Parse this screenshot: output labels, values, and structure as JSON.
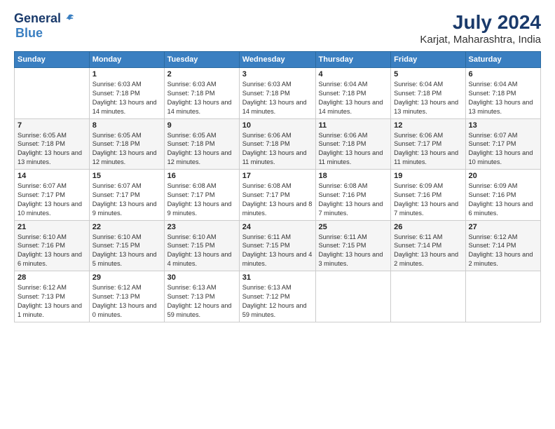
{
  "logo": {
    "general": "General",
    "blue": "Blue"
  },
  "title": "July 2024",
  "subtitle": "Karjat, Maharashtra, India",
  "weekdays": [
    "Sunday",
    "Monday",
    "Tuesday",
    "Wednesday",
    "Thursday",
    "Friday",
    "Saturday"
  ],
  "weeks": [
    [
      {
        "day": null
      },
      {
        "day": "1",
        "sunrise": "6:03 AM",
        "sunset": "7:18 PM",
        "daylight": "13 hours and 14 minutes."
      },
      {
        "day": "2",
        "sunrise": "6:03 AM",
        "sunset": "7:18 PM",
        "daylight": "13 hours and 14 minutes."
      },
      {
        "day": "3",
        "sunrise": "6:03 AM",
        "sunset": "7:18 PM",
        "daylight": "13 hours and 14 minutes."
      },
      {
        "day": "4",
        "sunrise": "6:04 AM",
        "sunset": "7:18 PM",
        "daylight": "13 hours and 14 minutes."
      },
      {
        "day": "5",
        "sunrise": "6:04 AM",
        "sunset": "7:18 PM",
        "daylight": "13 hours and 13 minutes."
      },
      {
        "day": "6",
        "sunrise": "6:04 AM",
        "sunset": "7:18 PM",
        "daylight": "13 hours and 13 minutes."
      }
    ],
    [
      {
        "day": "7",
        "sunrise": "6:05 AM",
        "sunset": "7:18 PM",
        "daylight": "13 hours and 13 minutes."
      },
      {
        "day": "8",
        "sunrise": "6:05 AM",
        "sunset": "7:18 PM",
        "daylight": "13 hours and 12 minutes."
      },
      {
        "day": "9",
        "sunrise": "6:05 AM",
        "sunset": "7:18 PM",
        "daylight": "13 hours and 12 minutes."
      },
      {
        "day": "10",
        "sunrise": "6:06 AM",
        "sunset": "7:18 PM",
        "daylight": "13 hours and 11 minutes."
      },
      {
        "day": "11",
        "sunrise": "6:06 AM",
        "sunset": "7:18 PM",
        "daylight": "13 hours and 11 minutes."
      },
      {
        "day": "12",
        "sunrise": "6:06 AM",
        "sunset": "7:17 PM",
        "daylight": "13 hours and 11 minutes."
      },
      {
        "day": "13",
        "sunrise": "6:07 AM",
        "sunset": "7:17 PM",
        "daylight": "13 hours and 10 minutes."
      }
    ],
    [
      {
        "day": "14",
        "sunrise": "6:07 AM",
        "sunset": "7:17 PM",
        "daylight": "13 hours and 10 minutes."
      },
      {
        "day": "15",
        "sunrise": "6:07 AM",
        "sunset": "7:17 PM",
        "daylight": "13 hours and 9 minutes."
      },
      {
        "day": "16",
        "sunrise": "6:08 AM",
        "sunset": "7:17 PM",
        "daylight": "13 hours and 9 minutes."
      },
      {
        "day": "17",
        "sunrise": "6:08 AM",
        "sunset": "7:17 PM",
        "daylight": "13 hours and 8 minutes."
      },
      {
        "day": "18",
        "sunrise": "6:08 AM",
        "sunset": "7:16 PM",
        "daylight": "13 hours and 7 minutes."
      },
      {
        "day": "19",
        "sunrise": "6:09 AM",
        "sunset": "7:16 PM",
        "daylight": "13 hours and 7 minutes."
      },
      {
        "day": "20",
        "sunrise": "6:09 AM",
        "sunset": "7:16 PM",
        "daylight": "13 hours and 6 minutes."
      }
    ],
    [
      {
        "day": "21",
        "sunrise": "6:10 AM",
        "sunset": "7:16 PM",
        "daylight": "13 hours and 6 minutes."
      },
      {
        "day": "22",
        "sunrise": "6:10 AM",
        "sunset": "7:15 PM",
        "daylight": "13 hours and 5 minutes."
      },
      {
        "day": "23",
        "sunrise": "6:10 AM",
        "sunset": "7:15 PM",
        "daylight": "13 hours and 4 minutes."
      },
      {
        "day": "24",
        "sunrise": "6:11 AM",
        "sunset": "7:15 PM",
        "daylight": "13 hours and 4 minutes."
      },
      {
        "day": "25",
        "sunrise": "6:11 AM",
        "sunset": "7:15 PM",
        "daylight": "13 hours and 3 minutes."
      },
      {
        "day": "26",
        "sunrise": "6:11 AM",
        "sunset": "7:14 PM",
        "daylight": "13 hours and 2 minutes."
      },
      {
        "day": "27",
        "sunrise": "6:12 AM",
        "sunset": "7:14 PM",
        "daylight": "13 hours and 2 minutes."
      }
    ],
    [
      {
        "day": "28",
        "sunrise": "6:12 AM",
        "sunset": "7:13 PM",
        "daylight": "13 hours and 1 minute."
      },
      {
        "day": "29",
        "sunrise": "6:12 AM",
        "sunset": "7:13 PM",
        "daylight": "13 hours and 0 minutes."
      },
      {
        "day": "30",
        "sunrise": "6:13 AM",
        "sunset": "7:13 PM",
        "daylight": "12 hours and 59 minutes."
      },
      {
        "day": "31",
        "sunrise": "6:13 AM",
        "sunset": "7:12 PM",
        "daylight": "12 hours and 59 minutes."
      },
      {
        "day": null
      },
      {
        "day": null
      },
      {
        "day": null
      }
    ]
  ]
}
